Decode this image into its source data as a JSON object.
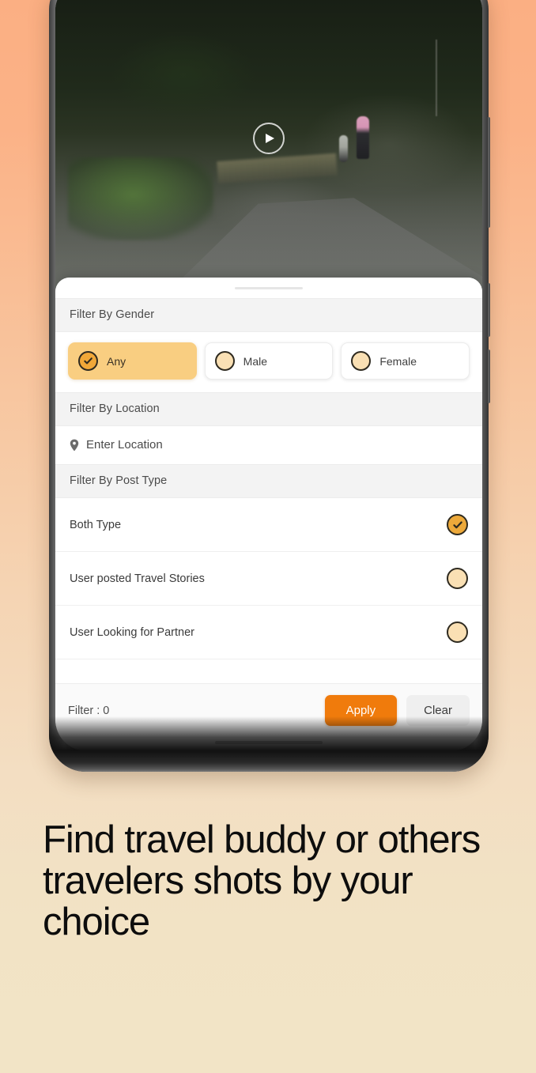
{
  "video": {
    "play_icon": "play-icon",
    "description": "travel video preview of forest road"
  },
  "sheet": {
    "gender": {
      "header": "Filter By Gender",
      "options": [
        {
          "label": "Any",
          "selected": true
        },
        {
          "label": "Male",
          "selected": false
        },
        {
          "label": "Female",
          "selected": false
        }
      ]
    },
    "location": {
      "header": "Filter By Location",
      "pin_icon": "location-pin-icon",
      "placeholder": "Enter Location",
      "value": ""
    },
    "post_type": {
      "header": "Filter By Post Type",
      "options": [
        {
          "label": "Both Type",
          "selected": true
        },
        {
          "label": "User posted Travel Stories",
          "selected": false
        },
        {
          "label": "User Looking for Partner",
          "selected": false
        }
      ]
    },
    "footer": {
      "filter_count_label": "Filter : 0",
      "apply_label": "Apply",
      "clear_label": "Clear"
    }
  },
  "headline": "Find travel buddy or others travelers shots by your choice",
  "colors": {
    "accent_orange": "#F07B0C",
    "amber_selected": "#EDA93A",
    "chip_selected_bg": "#F9CE81",
    "radio_unselected_fill": "#FAE0B4",
    "clear_bg": "#EFEFEF",
    "section_header_bg": "#F3F3F3"
  }
}
